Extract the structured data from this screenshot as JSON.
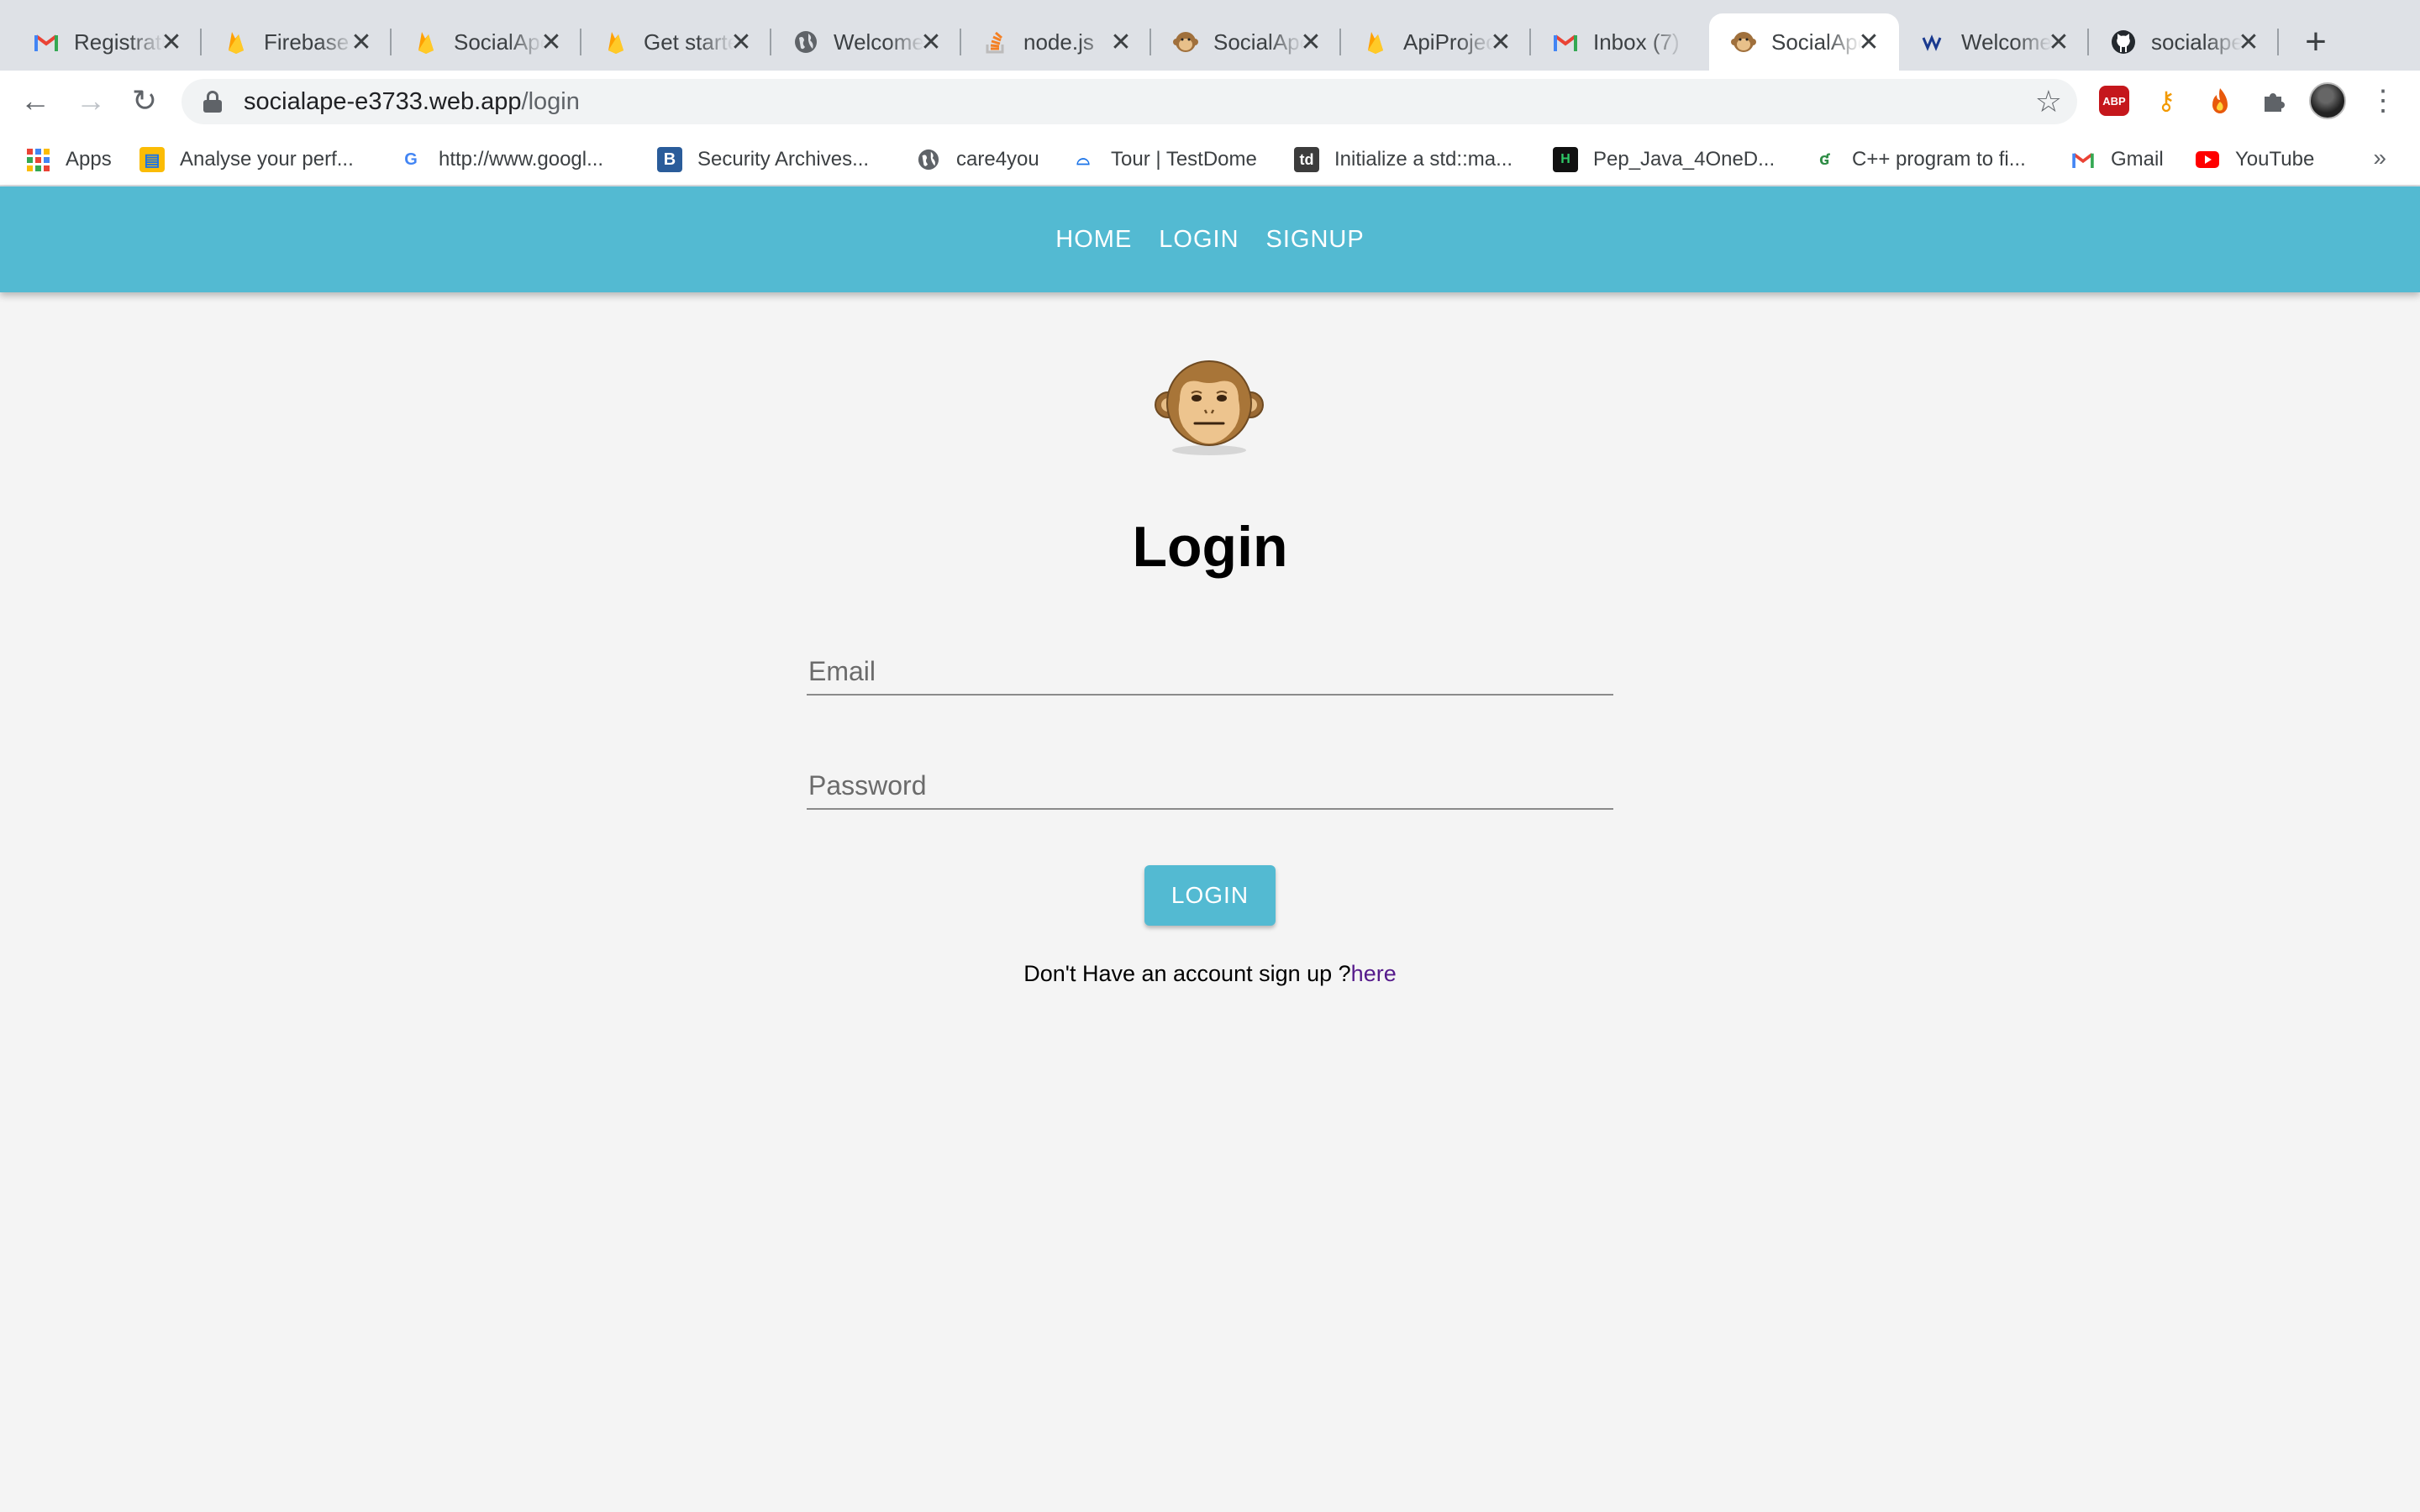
{
  "browser": {
    "tabs": [
      {
        "label": "Registration",
        "icon": "gmail-icon"
      },
      {
        "label": "Firebase",
        "icon": "firebase-icon"
      },
      {
        "label": "SocialApe",
        "icon": "firebase-icon"
      },
      {
        "label": "Get started",
        "icon": "firebase-icon"
      },
      {
        "label": "Welcome",
        "icon": "globe-icon"
      },
      {
        "label": "node.js",
        "icon": "stackoverflow-icon"
      },
      {
        "label": "SocialApe",
        "icon": "monkey-icon"
      },
      {
        "label": "ApiProject",
        "icon": "firebase-icon"
      },
      {
        "label": "Inbox (7)",
        "icon": "gmail-icon"
      },
      {
        "label": "SocialApe",
        "icon": "monkey-icon",
        "active": true
      },
      {
        "label": "Welcome",
        "icon": "welcome-icon"
      },
      {
        "label": "socialape",
        "icon": "github-icon"
      }
    ],
    "url_host": "socialape-e3733.web.app",
    "url_path": "/login",
    "bookmarks": [
      {
        "label": "Apps",
        "icon": "apps-grid-icon"
      },
      {
        "label": "Analyse your perf...",
        "icon": "analytics-icon"
      },
      {
        "label": "http://www.googl...",
        "icon": "google-icon"
      },
      {
        "label": "Security Archives...",
        "icon": "security-archives-icon"
      },
      {
        "label": "care4you",
        "icon": "globe-icon"
      },
      {
        "label": "Tour | TestDome",
        "icon": "testdome-icon"
      },
      {
        "label": "Initialize a std::ma...",
        "icon": "td-icon"
      },
      {
        "label": "Pep_Java_4OneD...",
        "icon": "hackerrank-icon"
      },
      {
        "label": "C++ program to fi...",
        "icon": "geeks-icon"
      },
      {
        "label": "Gmail",
        "icon": "gmail-icon"
      },
      {
        "label": "YouTube",
        "icon": "youtube-icon"
      }
    ]
  },
  "app": {
    "nav": {
      "home": "HOME",
      "login": "LOGIN",
      "signup": "SIGNUP"
    },
    "logo": "monkey-icon",
    "title": "Login",
    "email_placeholder": "Email",
    "password_placeholder": "Password",
    "login_button": "LOGIN",
    "signup_prompt": "Don't Have an account sign up ?",
    "signup_link": "here"
  },
  "colors": {
    "accent": "#53bad2",
    "background": "#f4f4f4",
    "link": "#551a8b"
  }
}
